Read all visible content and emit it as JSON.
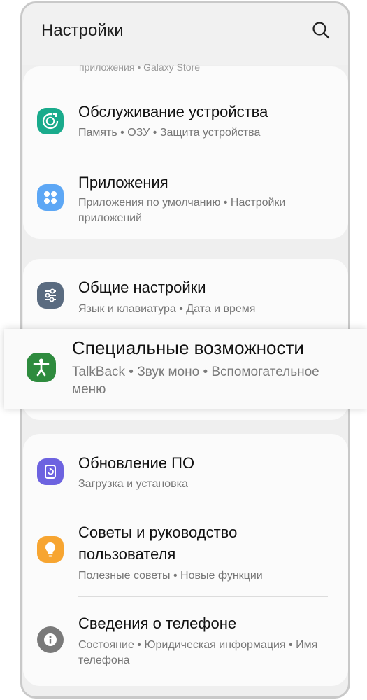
{
  "header": {
    "title": "Настройки",
    "search_icon": "search-icon"
  },
  "cut_off_text": "приложения  •  Galaxy Store",
  "colors": {
    "maintenance": "#1aab8c",
    "apps": "#5da7f5",
    "general": "#5a6b80",
    "accessibility": "#2e8b3e",
    "update": "#6d63e0",
    "tips": "#f7a531",
    "about": "#7a7a7a"
  },
  "items": [
    {
      "title": "Обслуживание устройства",
      "subtitle": "Память  •  ОЗУ  •  Защита устройства",
      "icon": "device-care-icon"
    },
    {
      "title": "Приложения",
      "subtitle": "Приложения по умолчанию  •  Настройки приложений",
      "icon": "apps-icon"
    },
    {
      "title": "Общие настройки",
      "subtitle": "Язык и клавиатура  •  Дата и время",
      "icon": "general-settings-icon"
    },
    {
      "title": "Специальные возможности",
      "subtitle": "TalkBack  •  Звук моно  •  Вспомогательное меню",
      "icon": "accessibility-icon"
    },
    {
      "title": "Обновление ПО",
      "subtitle": "Загрузка и установка",
      "icon": "software-update-icon"
    },
    {
      "title": "Советы и руководство пользователя",
      "subtitle": "Полезные советы  •  Новые функции",
      "icon": "tips-icon"
    },
    {
      "title": "Сведения о телефоне",
      "subtitle": "Состояние  •  Юридическая информация  •  Имя телефона",
      "icon": "info-icon"
    }
  ]
}
